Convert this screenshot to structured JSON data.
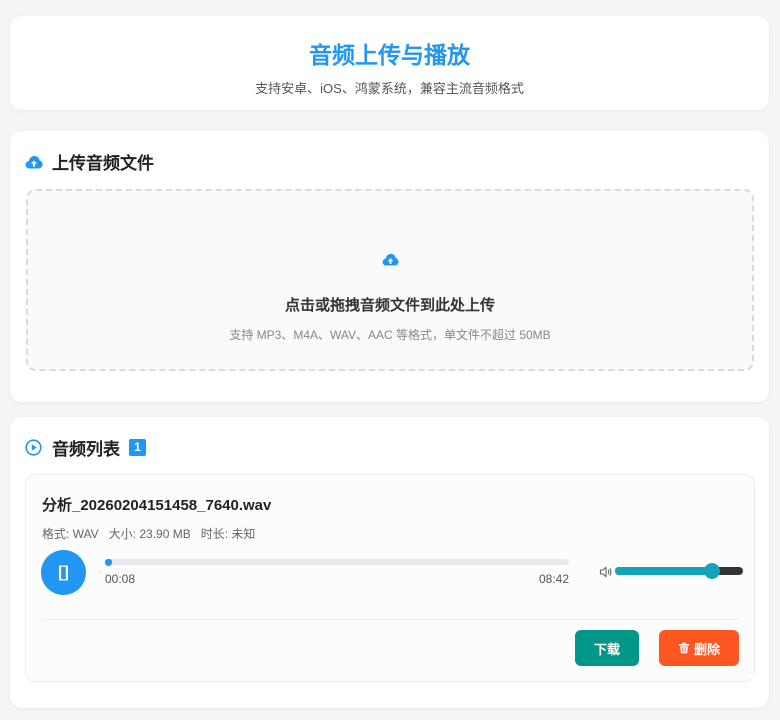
{
  "header": {
    "title": "音频上传与播放",
    "subtitle": "支持安卓、iOS、鸿蒙系统，兼容主流音频格式"
  },
  "upload": {
    "section_title": "上传音频文件",
    "icon": "cloud-upload-icon",
    "dropzone_title": "点击或拖拽音频文件到此处上传",
    "dropzone_hint": "支持 MP3、M4A、WAV、AAC 等格式，单文件不超过 50MB"
  },
  "list": {
    "section_title": "音频列表",
    "icon": "play-circle-icon",
    "count": "1",
    "items": [
      {
        "file_name": "分析_20260204151458_7640.wav",
        "format": "格式: WAV",
        "size": "大小: 23.90 MB",
        "duration": "时长: 未知",
        "play_label": "[]",
        "time_current": "00:08",
        "time_total": "08:42",
        "progress_fraction": 0.016,
        "volume_fraction": 0.76,
        "download_label": "下载",
        "delete_label": "删除"
      }
    ]
  },
  "colors": {
    "accent": "#2196f3",
    "download": "#009688",
    "delete": "#ff5722",
    "volume": "#17a2b8"
  }
}
